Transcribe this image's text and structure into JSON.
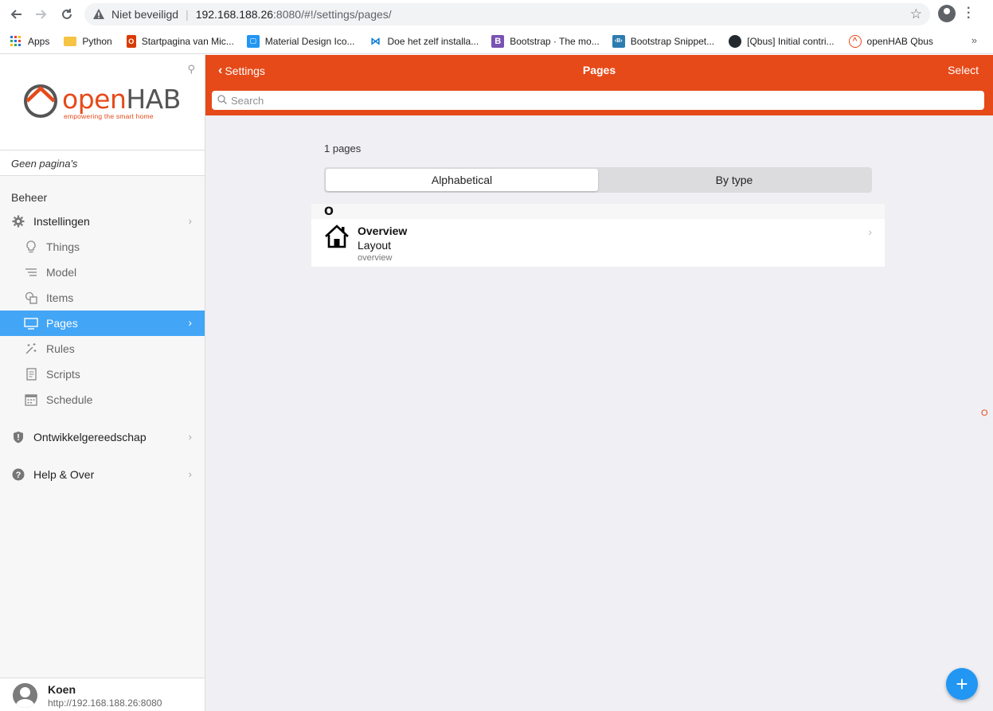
{
  "browser": {
    "security_label": "Niet beveiligd",
    "url_host": "192.168.188.26",
    "url_path": ":8080/#!/settings/pages/",
    "bookmarks": [
      {
        "label": "Apps",
        "icon": "apps-grid-icon",
        "color": "#1a73e8"
      },
      {
        "label": "Python",
        "icon": "folder-icon",
        "color": "#f6c343"
      },
      {
        "label": "Startpagina van Mic...",
        "icon": "office-icon",
        "color": "#d83b01"
      },
      {
        "label": "Material Design Ico...",
        "icon": "material-design-icon",
        "color": "#2196f3"
      },
      {
        "label": "Doe het zelf installa...",
        "icon": "butterfly-icon",
        "color": "#0078d4"
      },
      {
        "label": "Bootstrap · The mo...",
        "icon": "bootstrap-icon",
        "color": "#7952b3"
      },
      {
        "label": "Bootstrap Snippet...",
        "icon": "bootstrap-snippet-icon",
        "color": "#2c7cb0"
      },
      {
        "label": "[Qbus] Initial contri...",
        "icon": "github-icon",
        "color": "#24292e"
      },
      {
        "label": "openHAB Qbus",
        "icon": "openhab-icon",
        "color": "#e64a19"
      }
    ],
    "bookmarks_more": "»"
  },
  "sidebar": {
    "logo_open": "open",
    "logo_hab": "HAB",
    "logo_tagline": "empowering the smart home",
    "no_pages": "Geen pagina's",
    "section_title": "Beheer",
    "settings_label": "Instellingen",
    "sub_items": [
      {
        "label": "Things",
        "icon": "lightbulb-icon"
      },
      {
        "label": "Model",
        "icon": "list-tree-icon"
      },
      {
        "label": "Items",
        "icon": "items-icon"
      },
      {
        "label": "Pages",
        "icon": "monitor-icon"
      },
      {
        "label": "Rules",
        "icon": "wand-icon"
      },
      {
        "label": "Scripts",
        "icon": "script-icon"
      },
      {
        "label": "Schedule",
        "icon": "calendar-icon"
      }
    ],
    "dev_tools_label": "Ontwikkelgereedschap",
    "help_label": "Help & Over",
    "user_name": "Koen",
    "user_url": "http://192.168.188.26:8080"
  },
  "navbar": {
    "back_label": "Settings",
    "title": "Pages",
    "select_label": "Select",
    "search_placeholder": "Search"
  },
  "content": {
    "count_text": "1 pages",
    "segments": [
      "Alphabetical",
      "By type"
    ],
    "active_segment": "Alphabetical",
    "group_letter": "O",
    "rows": [
      {
        "title": "Overview",
        "subtitle": "Layout",
        "text": "overview",
        "icon": "house-icon"
      }
    ],
    "side_index_letter": "O"
  },
  "fab_label": "+",
  "colors": {
    "accent": "#e64a19",
    "active_menu": "#43a5f5",
    "fab": "#2196f3"
  }
}
